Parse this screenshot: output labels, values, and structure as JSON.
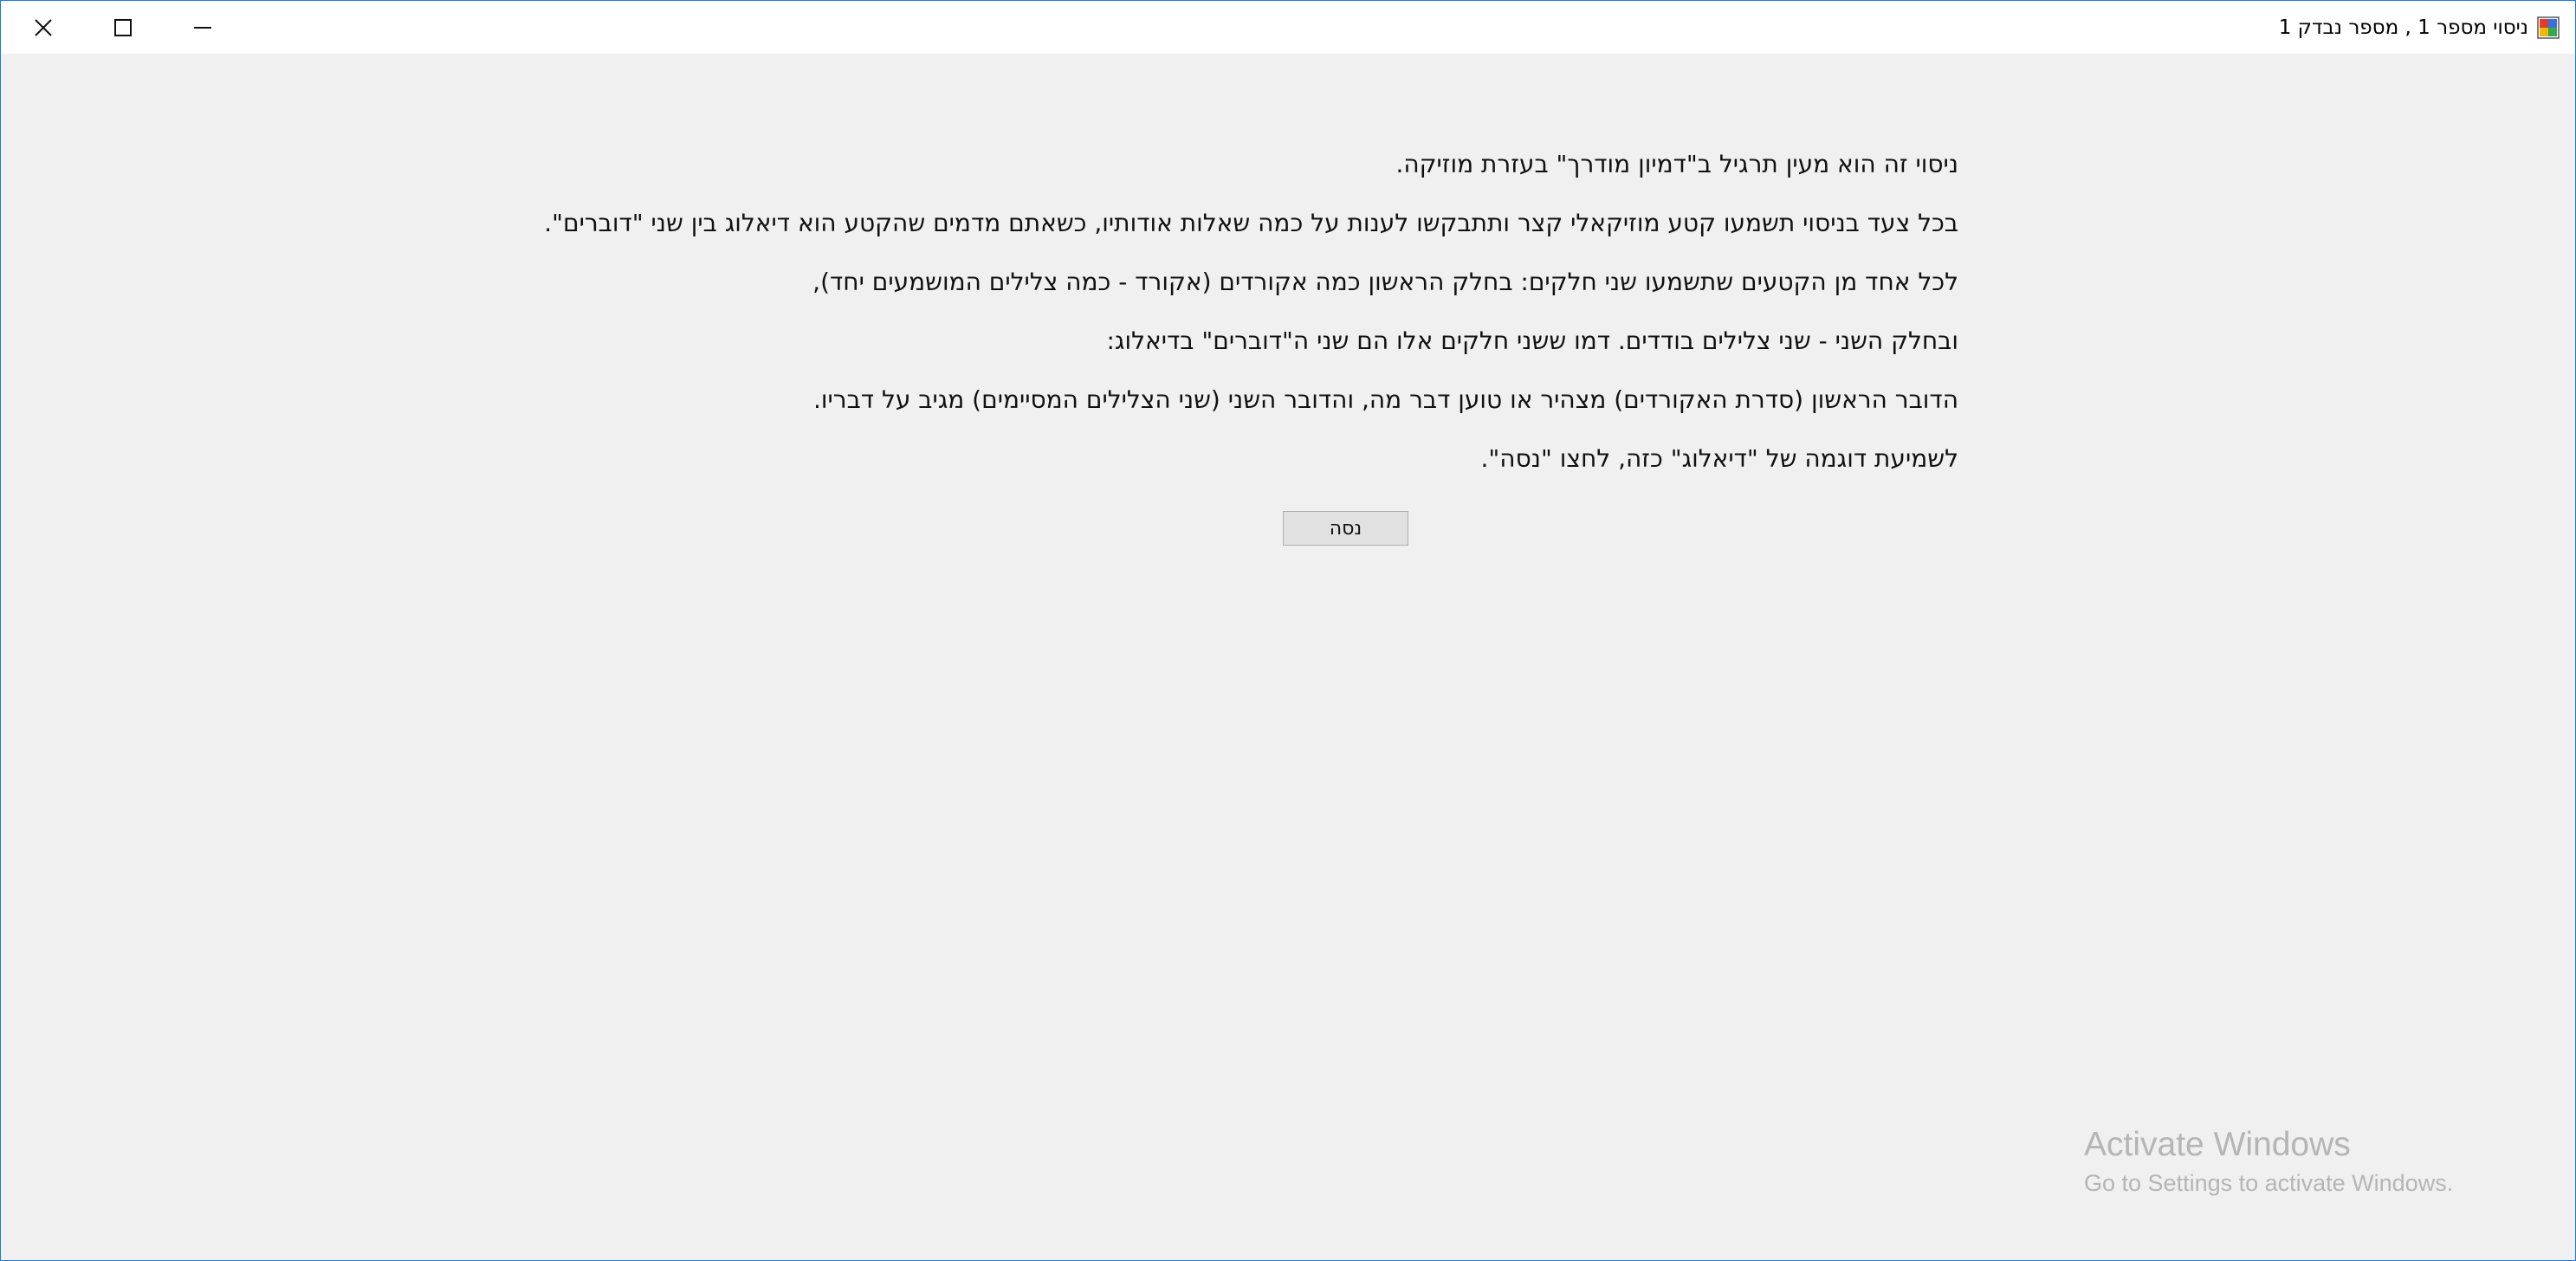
{
  "window": {
    "title": "ניסוי מספר 1 , מספר נבדק 1",
    "controls": {
      "close_icon": "close-icon",
      "maximize_icon": "maximize-icon",
      "minimize_icon": "minimize-icon"
    }
  },
  "instructions": {
    "lines": [
      "ניסוי זה הוא מעין תרגיל ב\"דמיון מודרך\" בעזרת מוזיקה.",
      "בכל צעד בניסוי תשמעו קטע מוזיקאלי קצר ותתבקשו לענות על כמה שאלות אודותיו, כשאתם מדמים שהקטע הוא דיאלוג בין שני \"דוברים\".",
      "לכל אחד מן הקטעים שתשמעו שני חלקים: בחלק הראשון כמה אקורדים (אקורד - כמה צלילים המושמעים יחד),",
      "ובחלק השני - שני צלילים בודדים. דמו ששני חלקים אלו הם שני ה\"דוברים\" בדיאלוג:",
      "הדובר הראשון (סדרת האקורדים) מצהיר או טוען דבר מה, והדובר השני (שני הצלילים המסיימים) מגיב על דבריו.",
      "לשמיעת דוגמה של \"דיאלוג\" כזה, לחצו \"נסה\"."
    ]
  },
  "try_button": {
    "label": "נסה"
  },
  "watermark": {
    "title": "Activate Windows",
    "subtitle": "Go to Settings to activate Windows."
  },
  "colors": {
    "window_border": "#1f7ad8",
    "background": "#f0f0f0",
    "titlebar": "#ffffff",
    "button_face": "#e1e1e1",
    "watermark_text": "#b5b5b5"
  }
}
